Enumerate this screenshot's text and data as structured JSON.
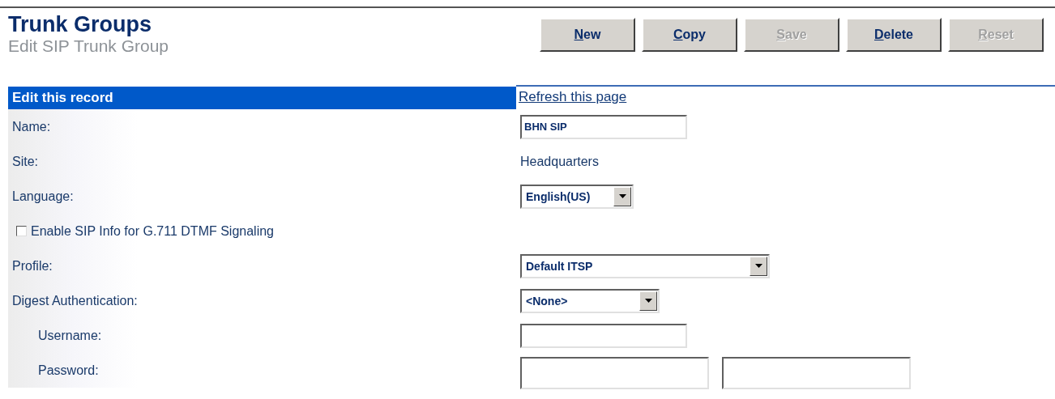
{
  "header": {
    "title": "Trunk Groups",
    "subtitle": "Edit SIP Trunk Group"
  },
  "toolbar": [
    {
      "label": "New",
      "disabled": false
    },
    {
      "label": "Copy",
      "disabled": false
    },
    {
      "label": "Save",
      "disabled": true
    },
    {
      "label": "Delete",
      "disabled": false
    },
    {
      "label": "Reset",
      "disabled": true
    }
  ],
  "section": {
    "title": "Edit this record",
    "link": "Refresh this page"
  },
  "fields": [
    {
      "kind": "text",
      "label": "Name:",
      "value": "BHN SIP",
      "indented": false
    },
    {
      "kind": "static",
      "label": "Site:",
      "value": "Headquarters",
      "indented": false
    },
    {
      "kind": "select",
      "label": "Language:",
      "value": "English(US)",
      "indented": false
    },
    {
      "kind": "checkbox",
      "label": "Enable SIP Info for G.711 DTMF Signaling",
      "checked": false
    },
    {
      "kind": "select",
      "label": "Profile:",
      "value": "Default ITSP",
      "indented": false
    },
    {
      "kind": "select",
      "label": "Digest Authentication:",
      "value": "<None>",
      "indented": false
    },
    {
      "kind": "text",
      "label": "Username:",
      "indented": true
    },
    {
      "kind": "password",
      "label": "Password:",
      "indented": true
    }
  ]
}
